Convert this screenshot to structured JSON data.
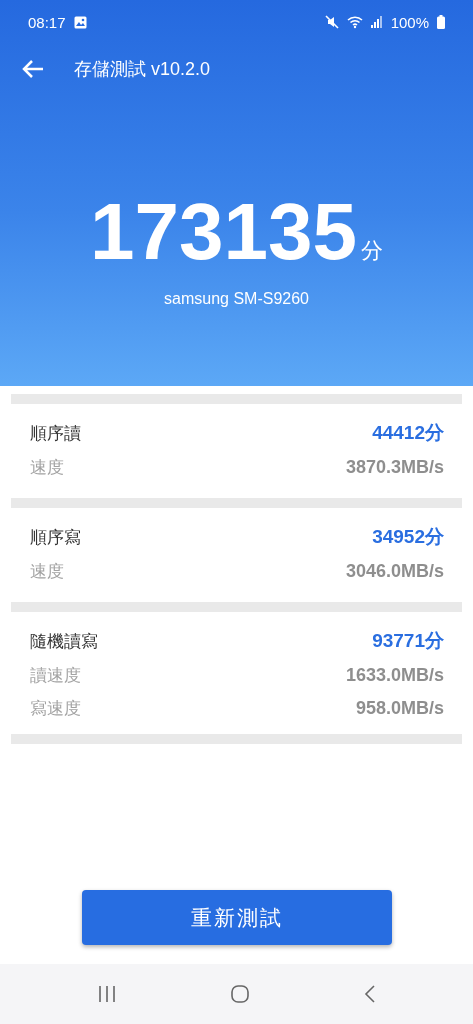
{
  "status_bar": {
    "time": "08:17",
    "battery": "100%"
  },
  "header": {
    "title": "存儲測試 v10.2.0"
  },
  "score": {
    "value": "173135",
    "unit": "分",
    "device": "samsung SM-S9260"
  },
  "sections": [
    {
      "title": "順序讀",
      "score": "44412分",
      "metrics": [
        {
          "label": "速度",
          "value": "3870.3MB/s"
        }
      ]
    },
    {
      "title": "順序寫",
      "score": "34952分",
      "metrics": [
        {
          "label": "速度",
          "value": "3046.0MB/s"
        }
      ]
    },
    {
      "title": "隨機讀寫",
      "score": "93771分",
      "metrics": [
        {
          "label": "讀速度",
          "value": "1633.0MB/s"
        },
        {
          "label": "寫速度",
          "value": "958.0MB/s"
        }
      ]
    }
  ],
  "retest_button": "重新測試"
}
